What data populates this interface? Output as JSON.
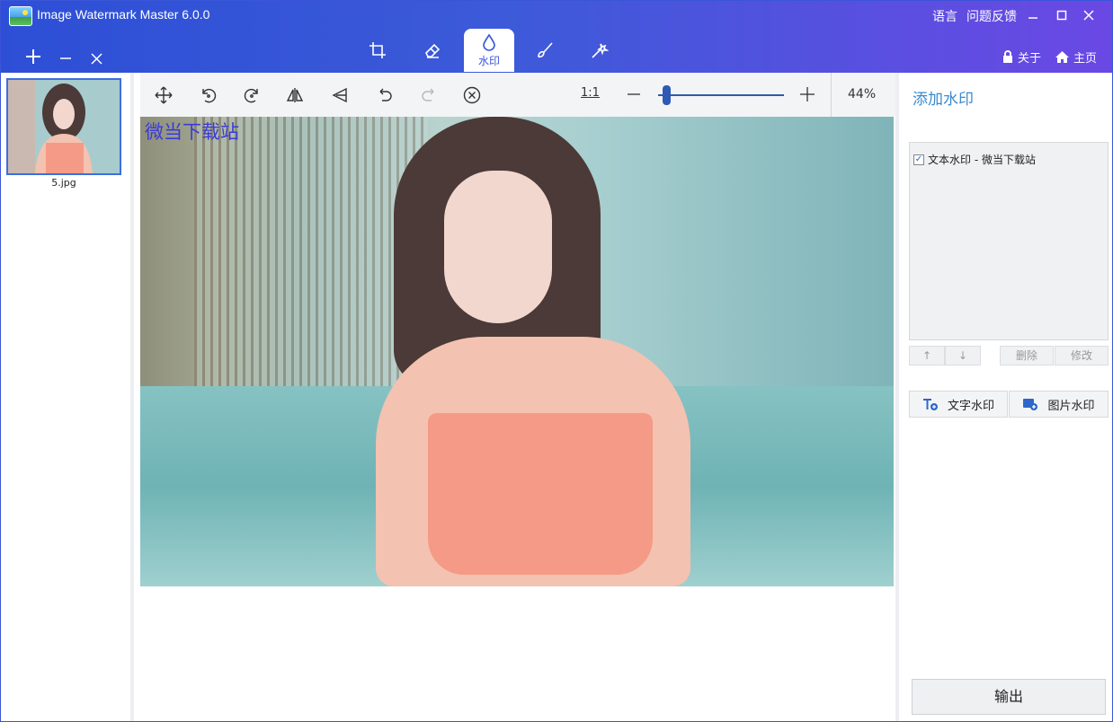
{
  "window": {
    "title": "Image Watermark Master 6.0.0",
    "language_label": "语言",
    "feedback_label": "问题反馈",
    "minimize": "—",
    "maximize": "☐",
    "close": "✕"
  },
  "doc_actions": {
    "add": "+",
    "remove": "–",
    "clear": "×"
  },
  "tool_tabs": [
    {
      "icon": "crop-icon"
    },
    {
      "icon": "eraser-icon"
    },
    {
      "icon": "water-drop-icon",
      "label": "水印",
      "active": true
    },
    {
      "icon": "brush-icon"
    },
    {
      "icon": "magic-wand-icon"
    }
  ],
  "header_right": {
    "about": "关于",
    "home": "主页"
  },
  "files": [
    {
      "name": "5.jpg"
    }
  ],
  "toolbar": {
    "ratio": "1:1",
    "zoom_minus": "—",
    "zoom_plus": "+",
    "zoom_value": "44%",
    "zoom_level_fraction": 0.05
  },
  "canvas": {
    "watermark_text": "微当下载站"
  },
  "right_panel": {
    "title": "添加水印",
    "watermarks": [
      {
        "label": "文本水印 - 微当下载站",
        "checked": true
      }
    ],
    "up": "↑",
    "down": "↓",
    "delete": "删除",
    "edit": "修改",
    "text_watermark": "文字水印",
    "image_watermark": "图片水印",
    "export": "输出"
  },
  "colors": {
    "accent": "#3b56d9",
    "title_blue": "#3a8ad0",
    "watermark_blue": "#3a3bd6"
  }
}
